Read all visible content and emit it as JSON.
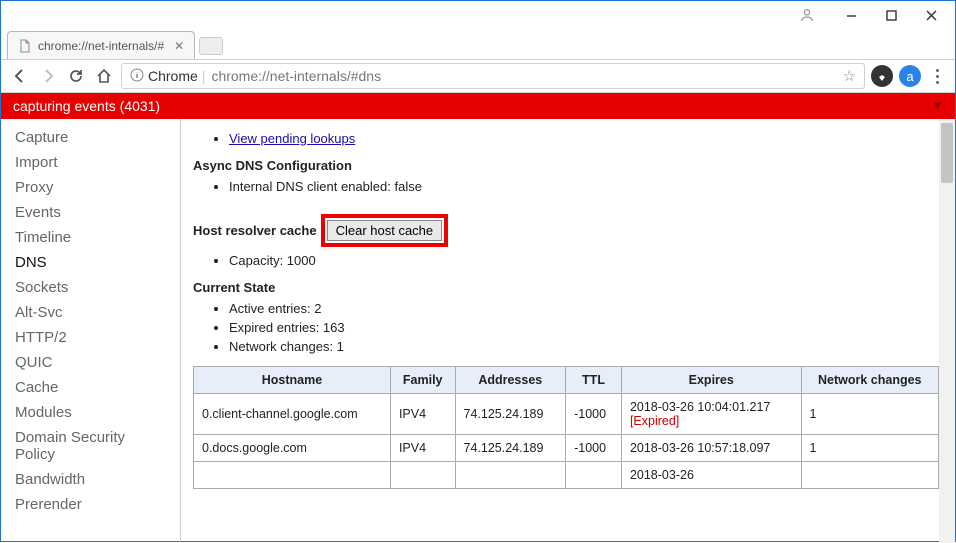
{
  "window": {
    "tab_title": "chrome://net-internals/#",
    "url_scheme": "Chrome",
    "url_path": "chrome://net-internals/#dns"
  },
  "capture_bar": {
    "text": "capturing events (4031)"
  },
  "sidebar": {
    "items": [
      {
        "label": "Capture"
      },
      {
        "label": "Import"
      },
      {
        "label": "Proxy"
      },
      {
        "label": "Events"
      },
      {
        "label": "Timeline"
      },
      {
        "label": "DNS",
        "active": true
      },
      {
        "label": "Sockets"
      },
      {
        "label": "Alt-Svc"
      },
      {
        "label": "HTTP/2"
      },
      {
        "label": "QUIC"
      },
      {
        "label": "Cache"
      },
      {
        "label": "Modules"
      },
      {
        "label": "Domain Security Policy"
      },
      {
        "label": "Bandwidth"
      },
      {
        "label": "Prerender"
      }
    ]
  },
  "main": {
    "pending_link": "View pending lookups",
    "async_heading": "Async DNS Configuration",
    "async_line": "Internal DNS client enabled: false",
    "resolver_label": "Host resolver cache",
    "clear_button": "Clear host cache",
    "capacity_line": "Capacity: 1000",
    "state_heading": "Current State",
    "state_items": [
      "Active entries: 2",
      "Expired entries: 163",
      "Network changes: 1"
    ],
    "table": {
      "headers": [
        "Hostname",
        "Family",
        "Addresses",
        "TTL",
        "Expires",
        "Network changes"
      ],
      "rows": [
        {
          "host": "0.client-channel.google.com",
          "family": "IPV4",
          "addr": "74.125.24.189",
          "ttl": "-1000",
          "expires": "2018-03-26 10:04:01.217",
          "expired": true,
          "net": "1"
        },
        {
          "host": "0.docs.google.com",
          "family": "IPV4",
          "addr": "74.125.24.189",
          "ttl": "-1000",
          "expires": "2018-03-26 10:57:18.097",
          "expired": false,
          "net": "1"
        },
        {
          "host": "",
          "family": "",
          "addr": "",
          "ttl": "",
          "expires": "2018-03-26",
          "expired": false,
          "net": ""
        }
      ]
    }
  }
}
